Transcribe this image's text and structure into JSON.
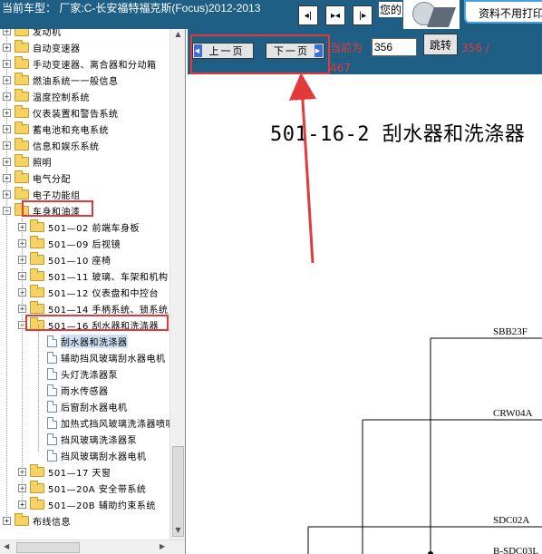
{
  "header": {
    "car_title": "当前车型：  厂家:C-长安福特福克斯(Focus)2012-2013",
    "nin_label": "您的",
    "notice": "资料不用打印",
    "nav_buttons": [
      "prev-icon",
      "both-icon",
      "next-icon"
    ]
  },
  "tree": {
    "items": [
      {
        "label": "发动机",
        "level": 0,
        "type": "folder",
        "exp": "+"
      },
      {
        "label": "自动变速器",
        "level": 0,
        "type": "folder",
        "exp": "+"
      },
      {
        "label": "手动变速器、离合器和分动箱",
        "level": 0,
        "type": "folder",
        "exp": "+"
      },
      {
        "label": "燃油系统一一般信息",
        "level": 0,
        "type": "folder",
        "exp": "+"
      },
      {
        "label": "温度控制系统",
        "level": 0,
        "type": "folder",
        "exp": "+"
      },
      {
        "label": "仪表装置和警告系统",
        "level": 0,
        "type": "folder",
        "exp": "+"
      },
      {
        "label": "蓄电池和充电系统",
        "level": 0,
        "type": "folder",
        "exp": "+"
      },
      {
        "label": "信息和娱乐系统",
        "level": 0,
        "type": "folder",
        "exp": "+"
      },
      {
        "label": "照明",
        "level": 0,
        "type": "folder",
        "exp": "+"
      },
      {
        "label": "电气分配",
        "level": 0,
        "type": "folder",
        "exp": "+"
      },
      {
        "label": "电子功能组",
        "level": 0,
        "type": "folder",
        "exp": "+"
      },
      {
        "label": "车身和油漆",
        "level": 0,
        "type": "folder",
        "exp": "−"
      },
      {
        "label": "501—02 前端车身板",
        "level": 1,
        "type": "folder",
        "exp": "+"
      },
      {
        "label": "501—09 后视镜",
        "level": 1,
        "type": "folder",
        "exp": "+"
      },
      {
        "label": "501—10 座椅",
        "level": 1,
        "type": "folder",
        "exp": "+"
      },
      {
        "label": "501—11 玻璃、车架和机构",
        "level": 1,
        "type": "folder",
        "exp": "+"
      },
      {
        "label": "501—12 仪表盘和中控台",
        "level": 1,
        "type": "folder",
        "exp": "+"
      },
      {
        "label": "501—14 手柄系统、锁系统",
        "level": 1,
        "type": "folder",
        "exp": "+"
      },
      {
        "label": "501—16 刮水器和洗涤器",
        "level": 1,
        "type": "folder",
        "exp": "−"
      },
      {
        "label": "刮水器和洗涤器",
        "level": 2,
        "type": "doc",
        "selected": true
      },
      {
        "label": "辅助挡风玻璃刮水器电机",
        "level": 2,
        "type": "doc"
      },
      {
        "label": "头灯洗涤器泵",
        "level": 2,
        "type": "doc"
      },
      {
        "label": "雨水传感器",
        "level": 2,
        "type": "doc"
      },
      {
        "label": "后窗刮水器电机",
        "level": 2,
        "type": "doc"
      },
      {
        "label": "加热式挡风玻璃洗涤器喷嘴",
        "level": 2,
        "type": "doc"
      },
      {
        "label": "挡风玻璃洗涤器泵",
        "level": 2,
        "type": "doc"
      },
      {
        "label": "挡风玻璃刮水器电机",
        "level": 2,
        "type": "doc"
      },
      {
        "label": "501—17 天窗",
        "level": 1,
        "type": "folder",
        "exp": "+"
      },
      {
        "label": "501—20A 安全带系统",
        "level": 1,
        "type": "folder",
        "exp": "+"
      },
      {
        "label": "501—20B 辅助约束系统",
        "level": 1,
        "type": "folder",
        "exp": "+"
      },
      {
        "label": "布线信息",
        "level": 0,
        "type": "folder",
        "exp": "+"
      }
    ]
  },
  "pager": {
    "prev_label": "上一页",
    "next_label": "下一页",
    "current_label": "当前为",
    "page_value": "356",
    "jump_label": "跳转",
    "total_a": "356 /",
    "total_b": "467"
  },
  "document": {
    "title": "501-16-2 刮水器和洗涤器",
    "signals": [
      "SBB23F",
      "CRW04A",
      "SDC02A",
      "B-SDC03L"
    ]
  },
  "colors": {
    "header_bg": "#1f5f86",
    "highlight": "#e23a3a",
    "selection": "#cfe0f4",
    "folder": "#f4d264"
  }
}
